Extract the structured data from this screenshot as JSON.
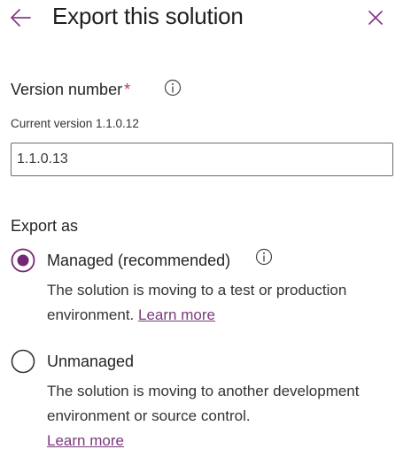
{
  "header": {
    "title": "Export this solution",
    "back_icon": "arrow-left-icon",
    "close_icon": "close-icon"
  },
  "version": {
    "label": "Version number",
    "required_marker": "*",
    "info_icon": "info-icon",
    "current_version_text": "Current version 1.1.0.12",
    "input_value": "1.1.0.13"
  },
  "export_as": {
    "label": "Export as",
    "options": [
      {
        "label": "Managed (recommended)",
        "selected": true,
        "description": "The solution is moving to a test or production environment.",
        "link_text": "Learn more"
      },
      {
        "label": "Unmanaged",
        "selected": false,
        "description": "The solution is moving to another development environment or source control.",
        "link_text": "Learn more"
      }
    ]
  },
  "colors": {
    "accent": "#742774",
    "required": "#c4314b",
    "link": "#7a3a7a",
    "text": "#242424"
  }
}
